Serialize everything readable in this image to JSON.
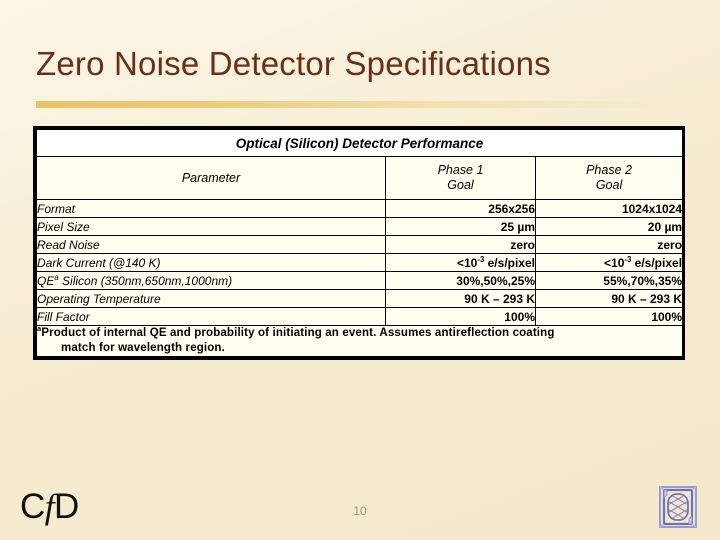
{
  "slide": {
    "title": "Zero Noise Detector Specifications",
    "number": "10"
  },
  "table": {
    "caption": "Optical (Silicon) Detector Performance",
    "headers": {
      "parameter": "Parameter",
      "phase1_line1": "Phase 1",
      "phase1_line2": "Goal",
      "phase2_line1": "Phase 2",
      "phase2_line2": "Goal"
    },
    "rows": [
      {
        "parameter": "Format",
        "parameter_sup": "",
        "phase1": "256x256",
        "phase1_pre": "",
        "phase1_sup": "",
        "phase1_post": "",
        "phase2": "1024x1024",
        "phase2_pre": "",
        "phase2_sup": "",
        "phase2_post": ""
      },
      {
        "parameter": "Pixel Size",
        "parameter_sup": "",
        "phase1": "25 µm",
        "phase1_pre": "",
        "phase1_sup": "",
        "phase1_post": "",
        "phase2": "20 µm",
        "phase2_pre": "",
        "phase2_sup": "",
        "phase2_post": ""
      },
      {
        "parameter": "Read Noise",
        "parameter_sup": "",
        "phase1": "zero",
        "phase1_pre": "",
        "phase1_sup": "",
        "phase1_post": "",
        "phase2": "zero",
        "phase2_pre": "",
        "phase2_sup": "",
        "phase2_post": ""
      },
      {
        "parameter": "Dark Current (@140 K)",
        "parameter_sup": "",
        "phase1": "",
        "phase1_pre": "<10",
        "phase1_sup": "-3",
        "phase1_post": " e/s/pixel",
        "phase2": "",
        "phase2_pre": "<10",
        "phase2_sup": "-3",
        "phase2_post": " e/s/pixel"
      },
      {
        "parameter": "QE",
        "parameter_sup": "a",
        "parameter_post": " Silicon (350nm,650nm,1000nm)",
        "phase1": "30%,50%,25%",
        "phase1_pre": "",
        "phase1_sup": "",
        "phase1_post": "",
        "phase2": "55%,70%,35%",
        "phase2_pre": "",
        "phase2_sup": "",
        "phase2_post": ""
      },
      {
        "parameter": "Operating Temperature",
        "parameter_sup": "",
        "phase1": "90 K – 293 K",
        "phase1_pre": "",
        "phase1_sup": "",
        "phase1_post": "",
        "phase2": "90 K – 293 K",
        "phase2_pre": "",
        "phase2_sup": "",
        "phase2_post": ""
      },
      {
        "parameter": "Fill Factor",
        "parameter_sup": "",
        "phase1": "100%",
        "phase1_pre": "",
        "phase1_sup": "",
        "phase1_post": "",
        "phase2": "100%",
        "phase2_pre": "",
        "phase2_sup": "",
        "phase2_post": ""
      }
    ],
    "footnote": {
      "marker": "a",
      "line1": "Product of internal QE and probability of initiating an event. Assumes antireflection coating",
      "line2": "match for wavelength region."
    }
  },
  "footer": {
    "logo_text_c": "C",
    "logo_text_f": "f",
    "logo_text_d": "D",
    "logo_mark_name": "ornamental-square-logo"
  },
  "colors": {
    "background": "#f6edd2",
    "title": "#6b2f19",
    "rule": "#e8c468",
    "table_border": "#000000",
    "caption_bg": "#ffffff",
    "body_bg": "#fffff0",
    "slide_number": "#9a9480",
    "logo_mark": "#6f6fc0"
  }
}
